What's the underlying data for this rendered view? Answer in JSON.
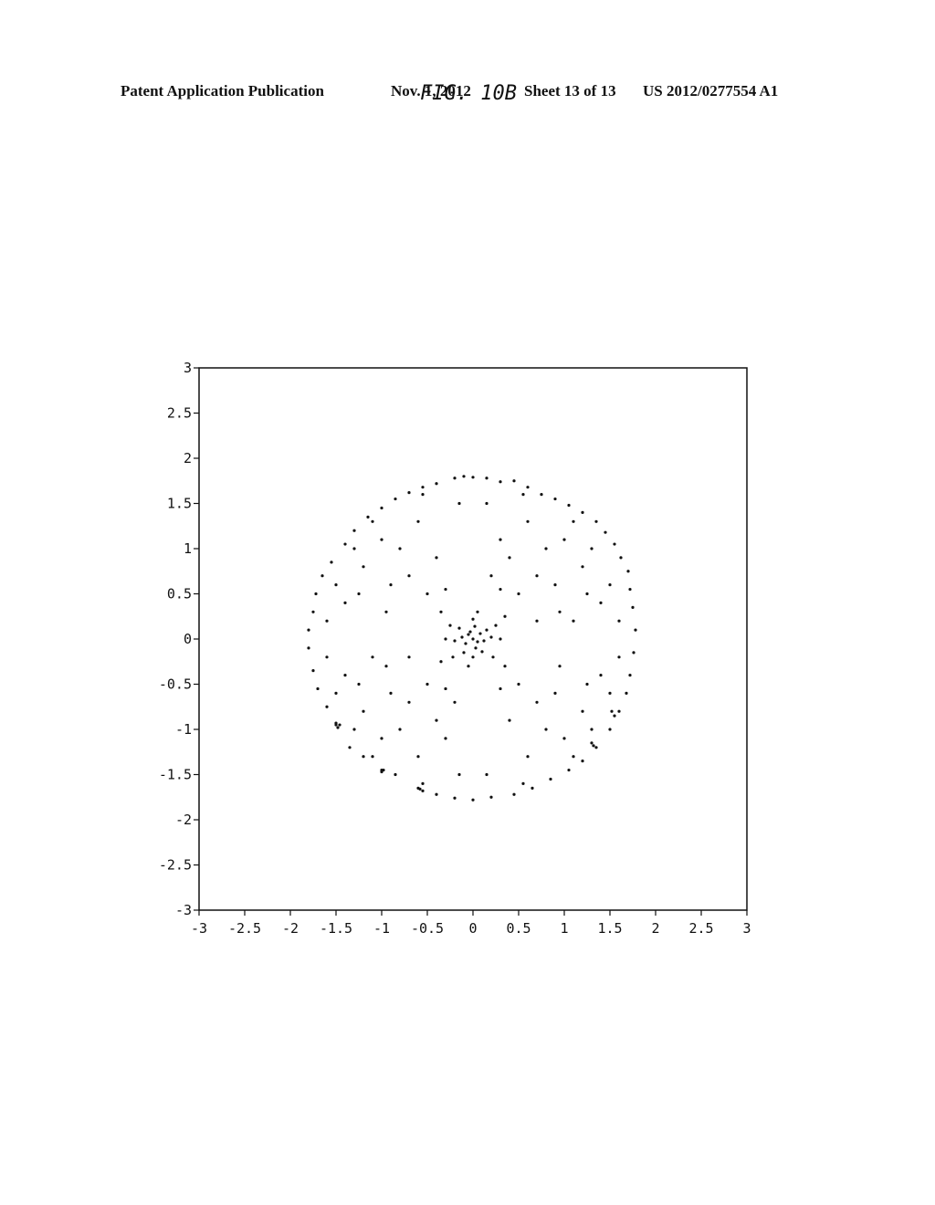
{
  "header": {
    "left": "Patent Application Publication",
    "date": "Nov. 1, 2012",
    "sheet": "Sheet 13 of 13",
    "number": "US 2012/0277554 A1"
  },
  "chart_data": {
    "type": "scatter",
    "title": "FIG. 10B",
    "xlabel": "",
    "ylabel": "",
    "xlim": [
      -3,
      3
    ],
    "ylim": [
      -3,
      3
    ],
    "grid": false,
    "legend": "none",
    "x_ticks": [
      "-3",
      "-2.5",
      "-2",
      "-1.5",
      "-1",
      "-0.5",
      "0",
      "0.5",
      "1",
      "1.5",
      "2",
      "2.5",
      "3"
    ],
    "y_ticks": [
      "3",
      "2.5",
      "2",
      "1.5",
      "1",
      "0.5",
      "0",
      "-0.5",
      "-1",
      "-1.5",
      "-2",
      "-2.5",
      "-3"
    ],
    "description": "Points uniformly distributed over a disc of radius ~1.8 centered at origin, with a dense cluster near (0,0). Representative sample of points shown.",
    "marker_color": "#111111",
    "points": [
      [
        -0.2,
        1.78
      ],
      [
        -0.1,
        1.8
      ],
      [
        0.0,
        1.79
      ],
      [
        0.15,
        1.78
      ],
      [
        0.3,
        1.74
      ],
      [
        0.45,
        1.75
      ],
      [
        0.6,
        1.68
      ],
      [
        0.75,
        1.6
      ],
      [
        0.9,
        1.55
      ],
      [
        1.05,
        1.48
      ],
      [
        1.2,
        1.4
      ],
      [
        1.35,
        1.3
      ],
      [
        1.45,
        1.18
      ],
      [
        1.55,
        1.05
      ],
      [
        1.62,
        0.9
      ],
      [
        1.7,
        0.75
      ],
      [
        1.72,
        0.55
      ],
      [
        1.75,
        0.35
      ],
      [
        1.78,
        0.1
      ],
      [
        1.76,
        -0.15
      ],
      [
        1.72,
        -0.4
      ],
      [
        1.68,
        -0.6
      ],
      [
        1.6,
        -0.8
      ],
      [
        1.5,
        -1.0
      ],
      [
        1.35,
        -1.2
      ],
      [
        1.2,
        -1.35
      ],
      [
        1.05,
        -1.45
      ],
      [
        0.85,
        -1.55
      ],
      [
        0.65,
        -1.65
      ],
      [
        0.45,
        -1.72
      ],
      [
        0.2,
        -1.75
      ],
      [
        0.0,
        -1.78
      ],
      [
        -0.2,
        -1.76
      ],
      [
        -0.4,
        -1.72
      ],
      [
        -0.6,
        -1.65
      ],
      [
        -0.85,
        -1.5
      ],
      [
        -1.0,
        -1.45
      ],
      [
        -1.2,
        -1.3
      ],
      [
        -1.35,
        -1.2
      ],
      [
        -1.5,
        -0.95
      ],
      [
        -1.6,
        -0.75
      ],
      [
        -1.7,
        -0.55
      ],
      [
        -1.75,
        -0.35
      ],
      [
        -1.8,
        -0.1
      ],
      [
        -1.8,
        0.1
      ],
      [
        -1.75,
        0.3
      ],
      [
        -1.72,
        0.5
      ],
      [
        -1.65,
        0.7
      ],
      [
        -1.55,
        0.85
      ],
      [
        -1.4,
        1.05
      ],
      [
        -1.3,
        1.2
      ],
      [
        -1.15,
        1.35
      ],
      [
        -1.0,
        1.45
      ],
      [
        -0.85,
        1.55
      ],
      [
        -0.7,
        1.62
      ],
      [
        -0.55,
        1.68
      ],
      [
        -0.4,
        1.72
      ],
      [
        -0.05,
        0.05
      ],
      [
        0.0,
        0.0
      ],
      [
        0.05,
        -0.03
      ],
      [
        -0.03,
        0.08
      ],
      [
        0.08,
        0.06
      ],
      [
        -0.08,
        -0.05
      ],
      [
        0.03,
        -0.1
      ],
      [
        -0.12,
        0.02
      ],
      [
        0.12,
        -0.02
      ],
      [
        0.02,
        0.14
      ],
      [
        -0.15,
        0.12
      ],
      [
        0.15,
        0.1
      ],
      [
        -0.1,
        -0.15
      ],
      [
        0.1,
        -0.14
      ],
      [
        0.2,
        0.02
      ],
      [
        -0.2,
        -0.02
      ],
      [
        0.0,
        -0.2
      ],
      [
        0.0,
        0.22
      ],
      [
        0.25,
        0.15
      ],
      [
        -0.25,
        0.15
      ],
      [
        0.22,
        -0.2
      ],
      [
        -0.22,
        -0.2
      ],
      [
        0.3,
        0.0
      ],
      [
        -0.3,
        0.0
      ],
      [
        0.05,
        0.3
      ],
      [
        -0.05,
        -0.3
      ],
      [
        0.35,
        0.25
      ],
      [
        -0.35,
        -0.25
      ],
      [
        0.35,
        -0.3
      ],
      [
        -0.35,
        0.3
      ],
      [
        0.5,
        0.5
      ],
      [
        -0.5,
        0.5
      ],
      [
        0.5,
        -0.5
      ],
      [
        -0.5,
        -0.5
      ],
      [
        0.7,
        0.2
      ],
      [
        -0.7,
        -0.2
      ],
      [
        0.2,
        0.7
      ],
      [
        -0.2,
        -0.7
      ],
      [
        0.9,
        0.6
      ],
      [
        -0.9,
        0.6
      ],
      [
        0.9,
        -0.6
      ],
      [
        -0.9,
        -0.6
      ],
      [
        1.1,
        0.2
      ],
      [
        -1.1,
        -0.2
      ],
      [
        0.3,
        1.1
      ],
      [
        -0.3,
        -1.1
      ],
      [
        1.2,
        0.8
      ],
      [
        -1.2,
        0.8
      ],
      [
        1.2,
        -0.8
      ],
      [
        -1.2,
        -0.8
      ],
      [
        0.6,
        1.3
      ],
      [
        -0.6,
        1.3
      ],
      [
        0.6,
        -1.3
      ],
      [
        -0.6,
        -1.3
      ],
      [
        1.4,
        0.4
      ],
      [
        -1.4,
        0.4
      ],
      [
        1.4,
        -0.4
      ],
      [
        -1.4,
        -0.4
      ],
      [
        0.8,
        1.0
      ],
      [
        -0.8,
        1.0
      ],
      [
        0.8,
        -1.0
      ],
      [
        -0.8,
        -1.0
      ],
      [
        1.0,
        1.1
      ],
      [
        -1.0,
        1.1
      ],
      [
        1.0,
        -1.1
      ],
      [
        -1.0,
        -1.1
      ],
      [
        0.4,
        0.9
      ],
      [
        -0.4,
        0.9
      ],
      [
        0.4,
        -0.9
      ],
      [
        -0.4,
        -0.9
      ],
      [
        1.5,
        0.6
      ],
      [
        -1.5,
        0.6
      ],
      [
        1.5,
        -0.6
      ],
      [
        -1.5,
        -0.6
      ],
      [
        0.15,
        1.5
      ],
      [
        -0.15,
        1.5
      ],
      [
        0.15,
        -1.5
      ],
      [
        -0.15,
        -1.5
      ],
      [
        1.3,
        1.0
      ],
      [
        -1.3,
        1.0
      ],
      [
        1.3,
        -1.0
      ],
      [
        -1.3,
        -1.0
      ],
      [
        0.7,
        0.7
      ],
      [
        -0.7,
        0.7
      ],
      [
        0.7,
        -0.7
      ],
      [
        -0.7,
        -0.7
      ],
      [
        1.6,
        0.2
      ],
      [
        -1.6,
        0.2
      ],
      [
        1.6,
        -0.2
      ],
      [
        -1.6,
        -0.2
      ],
      [
        0.95,
        0.3
      ],
      [
        -0.95,
        0.3
      ],
      [
        0.95,
        -0.3
      ],
      [
        -0.95,
        -0.3
      ],
      [
        0.3,
        0.55
      ],
      [
        -0.3,
        0.55
      ],
      [
        0.3,
        -0.55
      ],
      [
        -0.3,
        -0.55
      ],
      [
        1.1,
        1.3
      ],
      [
        -1.1,
        1.3
      ],
      [
        1.1,
        -1.3
      ],
      [
        -1.1,
        -1.3
      ],
      [
        0.55,
        1.6
      ],
      [
        -0.55,
        1.6
      ],
      [
        0.55,
        -1.6
      ],
      [
        -0.55,
        -1.6
      ],
      [
        1.25,
        0.5
      ],
      [
        -1.25,
        0.5
      ],
      [
        1.25,
        -0.5
      ],
      [
        -1.25,
        -0.5
      ],
      [
        -1.48,
        -0.98
      ],
      [
        -1.46,
        -0.95
      ],
      [
        -1.5,
        -0.93
      ],
      [
        -1.0,
        -1.47
      ],
      [
        -0.98,
        -1.45
      ],
      [
        -0.55,
        -1.68
      ],
      [
        -0.58,
        -1.66
      ],
      [
        1.3,
        -1.15
      ],
      [
        1.32,
        -1.18
      ],
      [
        1.55,
        -0.85
      ],
      [
        1.52,
        -0.8
      ]
    ]
  }
}
